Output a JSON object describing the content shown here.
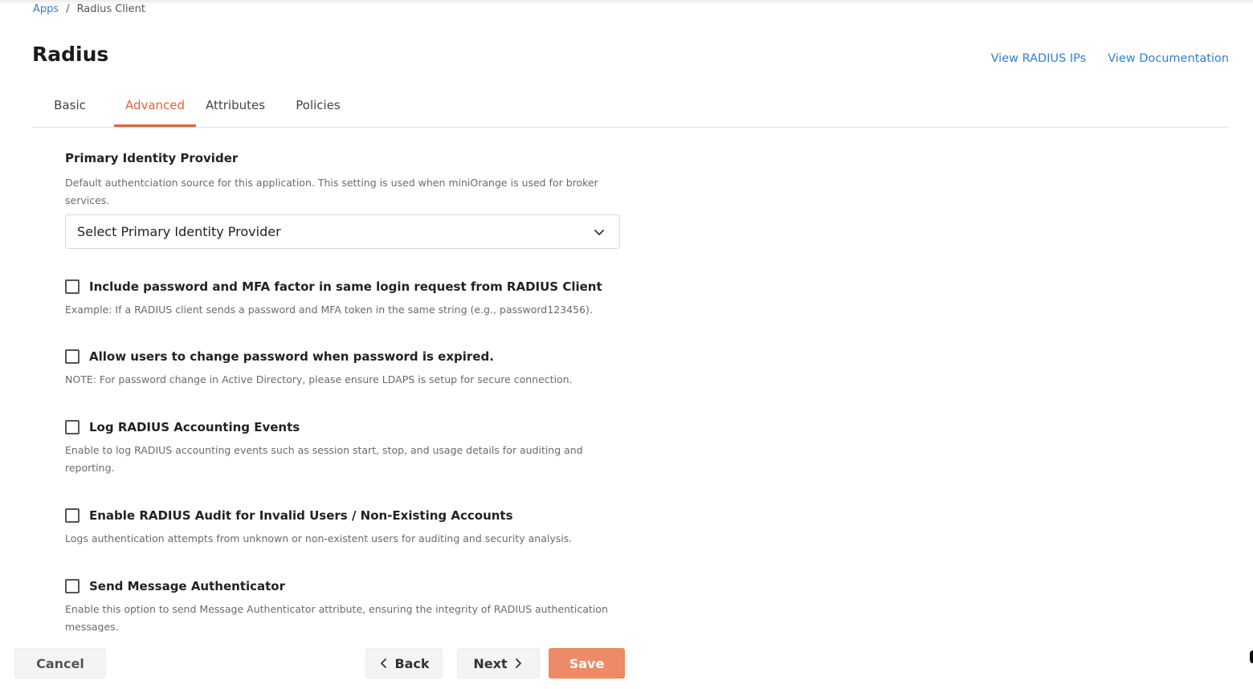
{
  "breadcrumb": {
    "root": "Apps",
    "separator": "/",
    "current": "Radius Client"
  },
  "page": {
    "title": "Radius"
  },
  "header_links": {
    "view_ips": "View RADIUS IPs",
    "view_docs": "View Documentation"
  },
  "tabs": [
    {
      "label": "Basic",
      "active": false
    },
    {
      "label": "Advanced",
      "active": true
    },
    {
      "label": "Attributes",
      "active": false
    },
    {
      "label": "Policies",
      "active": false
    }
  ],
  "primary_idp": {
    "title": "Primary Identity Provider",
    "description": "Default authentciation source for this application. This setting is used when miniOrange is used for broker services.",
    "select_value": "Select Primary Identity Provider"
  },
  "options": [
    {
      "label": "Include password and MFA factor in same login request from RADIUS Client",
      "description": "Example: If a RADIUS client sends a password and MFA token in the same string (e.g., password123456).",
      "checked": false
    },
    {
      "label": "Allow users to change password when password is expired.",
      "description": "NOTE: For password change in Active Directory, please ensure LDAPS is setup for secure connection.",
      "checked": false
    },
    {
      "label": "Log RADIUS Accounting Events",
      "description": "Enable to log RADIUS accounting events such as session start, stop, and usage details for auditing and reporting.",
      "checked": false
    },
    {
      "label": "Enable RADIUS Audit for Invalid Users / Non-Existing Accounts",
      "description": "Logs authentication attempts from unknown or non-existent users for auditing and security analysis.",
      "checked": false
    },
    {
      "label": "Send Message Authenticator",
      "description": "Enable this option to send Message Authenticator attribute, ensuring the integrity of RADIUS authentication messages.",
      "checked": false
    }
  ],
  "footer": {
    "cancel": "Cancel",
    "back": "Back",
    "next": "Next",
    "save": "Save"
  },
  "colors": {
    "accent": "#e0633b",
    "save_button": "#ee8a65",
    "link": "#2f7fd6"
  },
  "icons": {
    "select": "chevron-down-icon",
    "back": "chevron-left-icon",
    "next": "chevron-right-icon"
  }
}
